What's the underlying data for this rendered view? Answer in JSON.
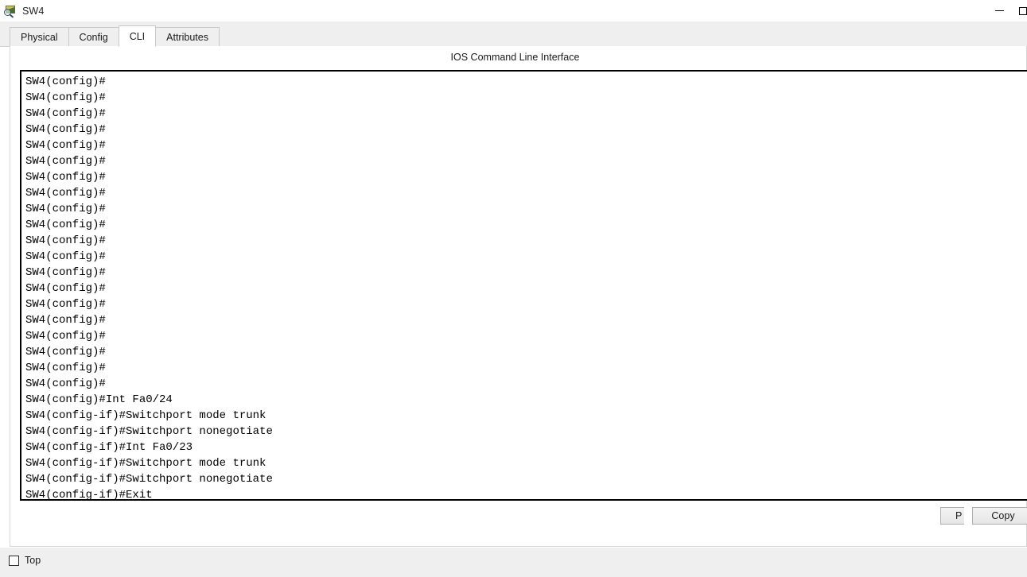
{
  "window": {
    "title": "SW4",
    "icon": "device-inspect-icon",
    "controls": [
      {
        "name": "minimize-button",
        "glyph": "minimize"
      },
      {
        "name": "maximize-button",
        "glyph": "maximize"
      }
    ]
  },
  "tabs": [
    {
      "label": "Physical",
      "active": false,
      "name": "tab-physical"
    },
    {
      "label": "Config",
      "active": false,
      "name": "tab-config"
    },
    {
      "label": "CLI",
      "active": true,
      "name": "tab-cli"
    },
    {
      "label": "Attributes",
      "active": false,
      "name": "tab-attributes"
    }
  ],
  "cli": {
    "header": "IOS Command Line Interface",
    "lines": [
      "SW4(config)#",
      "SW4(config)#",
      "SW4(config)#",
      "SW4(config)#",
      "SW4(config)#",
      "SW4(config)#",
      "SW4(config)#",
      "SW4(config)#",
      "SW4(config)#",
      "SW4(config)#",
      "SW4(config)#",
      "SW4(config)#",
      "SW4(config)#",
      "SW4(config)#",
      "SW4(config)#",
      "SW4(config)#",
      "SW4(config)#",
      "SW4(config)#",
      "SW4(config)#",
      "SW4(config)#",
      "SW4(config)#Int Fa0/24",
      "SW4(config-if)#Switchport mode trunk",
      "SW4(config-if)#Switchport nonegotiate",
      "SW4(config-if)#Int Fa0/23",
      "SW4(config-if)#Switchport mode trunk",
      "SW4(config-if)#Switchport nonegotiate",
      "SW4(config-if)#Exit"
    ],
    "prompt_line": "SW4(config)#"
  },
  "buttons": {
    "copy": "Copy",
    "paste": "P"
  },
  "footer": {
    "top_checkbox_label": "Top",
    "top_checkbox_checked": false
  },
  "colors": {
    "titlebar_bg": "#ffffff",
    "tabstrip_bg": "#efefef",
    "panel_bg": "#ffffff",
    "terminal_bg": "#ffffff",
    "terminal_fg": "#000000",
    "footer_bg": "#efefef"
  }
}
